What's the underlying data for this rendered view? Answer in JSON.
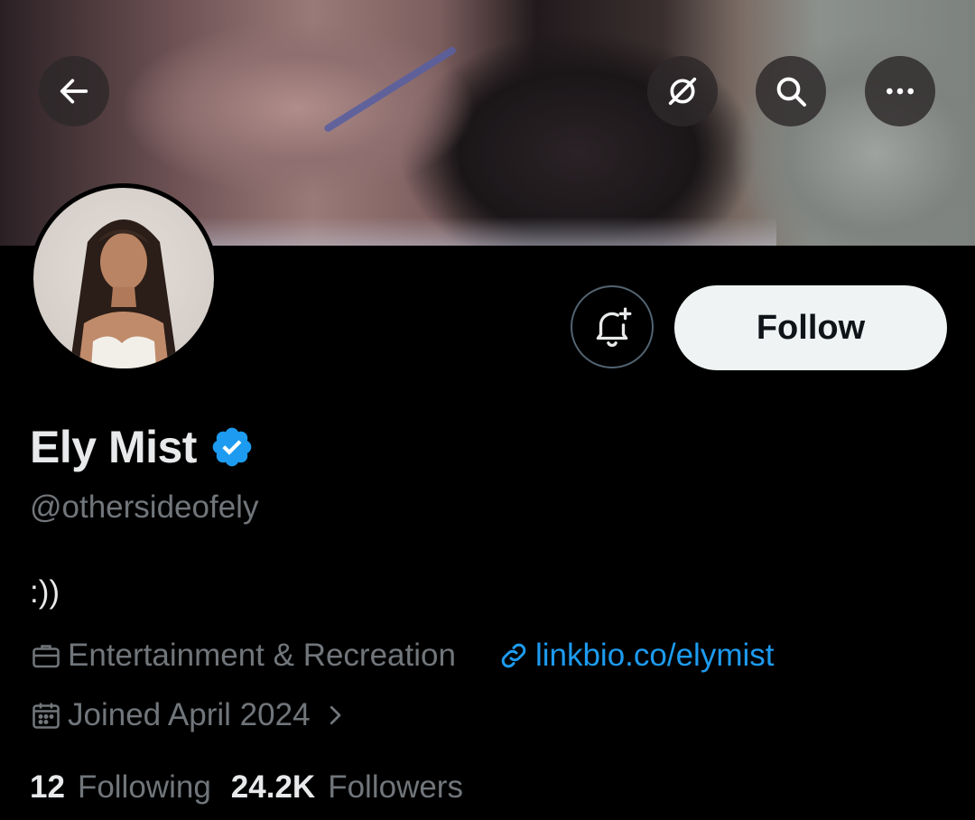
{
  "header": {
    "back_icon": "arrow-left-icon",
    "grok_icon": "grok-icon",
    "search_icon": "search-icon",
    "more_icon": "more-horizontal-icon"
  },
  "profile": {
    "display_name": "Ely Mist",
    "verified": true,
    "handle": "@othersideofely",
    "bio": ":))",
    "category": "Entertainment & Recreation",
    "link": "linkbio.co/elymist",
    "joined": "Joined April 2024",
    "following_count": "12",
    "following_label": "Following",
    "followers_count": "24.2K",
    "followers_label": "Followers"
  },
  "actions": {
    "follow_label": "Follow",
    "notify_icon": "bell-plus-icon"
  },
  "colors": {
    "accent": "#1d9bf0",
    "muted_text": "#71767b",
    "primary_text": "#e7e9ea",
    "follow_bg": "#eff3f4"
  }
}
